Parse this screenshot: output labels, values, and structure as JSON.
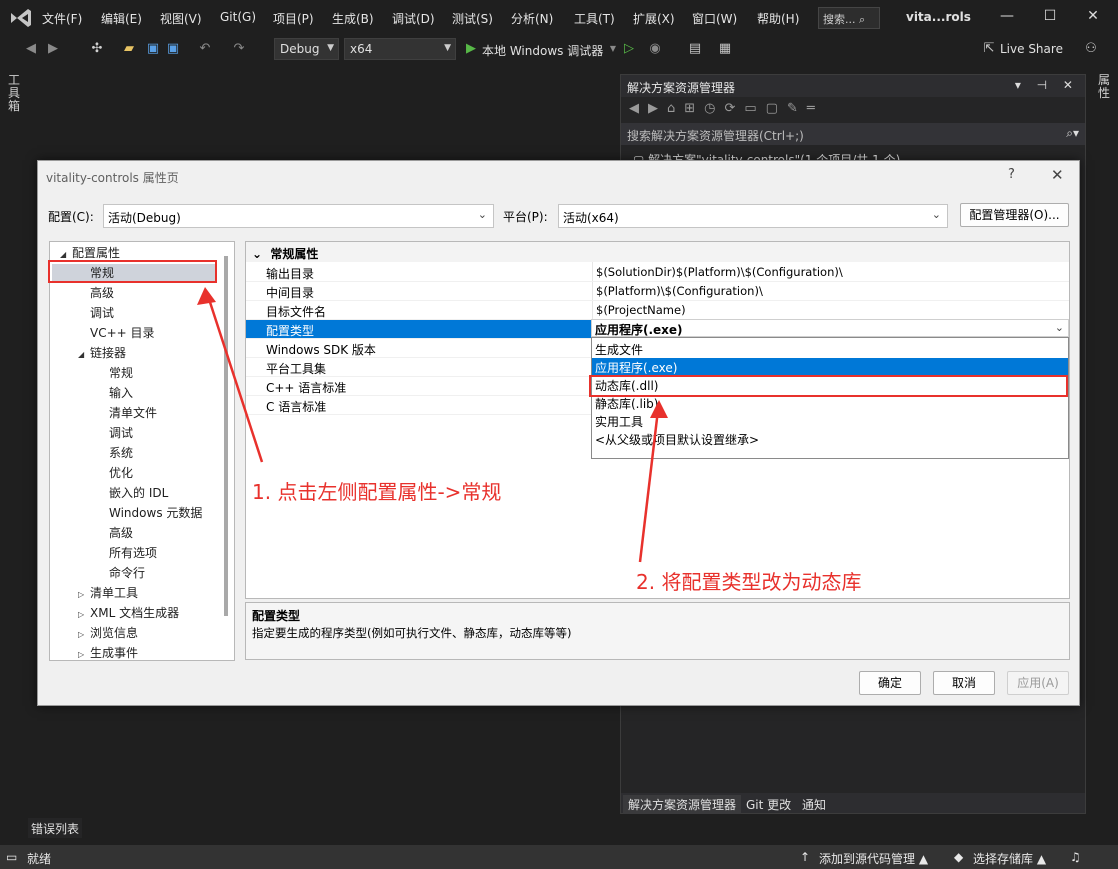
{
  "menu": [
    "文件(F)",
    "编辑(E)",
    "视图(V)",
    "Git(G)",
    "项目(P)",
    "生成(B)",
    "调试(D)",
    "测试(S)",
    "分析(N)",
    "工具(T)",
    "扩展(X)",
    "窗口(W)",
    "帮助(H)"
  ],
  "search_label": "搜索...",
  "window_title": "vita...rols",
  "toolbar": {
    "config": "Debug",
    "platform": "x64",
    "run_label": "本地 Windows 调试器",
    "live_share": "Live Share"
  },
  "left_vertical_tab": "工具箱",
  "right_vertical_tab": "属性",
  "solution_explorer": {
    "title": "解决方案资源管理器",
    "search_placeholder": "搜索解决方案资源管理器(Ctrl+;)",
    "root_item": "解决方案\"vitality-controls\"(1 个项目/共 1 个)",
    "tabs": [
      "解决方案资源管理器",
      "Git 更改",
      "通知"
    ]
  },
  "error_list_tab": "错误列表",
  "status": {
    "ready": "就绪",
    "add_source": "添加到源代码管理",
    "select_repo": "选择存储库"
  },
  "dialog": {
    "title": "vitality-controls 属性页",
    "config_label": "配置(C):",
    "config_value": "活动(Debug)",
    "platform_label": "平台(P):",
    "platform_value": "活动(x64)",
    "config_manager_button": "配置管理器(O)...",
    "tree": [
      {
        "label": "配置属性",
        "level": 0,
        "arrow": "expanded"
      },
      {
        "label": "常规",
        "level": 1,
        "arrow": "none",
        "selected": true
      },
      {
        "label": "高级",
        "level": 1,
        "arrow": "none"
      },
      {
        "label": "调试",
        "level": 1,
        "arrow": "none"
      },
      {
        "label": "VC++ 目录",
        "level": 1,
        "arrow": "none"
      },
      {
        "label": "链接器",
        "level": 1,
        "arrow": "expanded"
      },
      {
        "label": "常规",
        "level": 2,
        "arrow": "none"
      },
      {
        "label": "输入",
        "level": 2,
        "arrow": "none"
      },
      {
        "label": "清单文件",
        "level": 2,
        "arrow": "none"
      },
      {
        "label": "调试",
        "level": 2,
        "arrow": "none"
      },
      {
        "label": "系统",
        "level": 2,
        "arrow": "none"
      },
      {
        "label": "优化",
        "level": 2,
        "arrow": "none"
      },
      {
        "label": "嵌入的 IDL",
        "level": 2,
        "arrow": "none"
      },
      {
        "label": "Windows 元数据",
        "level": 2,
        "arrow": "none"
      },
      {
        "label": "高级",
        "level": 2,
        "arrow": "none"
      },
      {
        "label": "所有选项",
        "level": 2,
        "arrow": "none"
      },
      {
        "label": "命令行",
        "level": 2,
        "arrow": "none"
      },
      {
        "label": "清单工具",
        "level": 1,
        "arrow": "collapsed"
      },
      {
        "label": "XML 文档生成器",
        "level": 1,
        "arrow": "collapsed"
      },
      {
        "label": "浏览信息",
        "level": 1,
        "arrow": "collapsed"
      },
      {
        "label": "生成事件",
        "level": 1,
        "arrow": "collapsed"
      }
    ],
    "grid_category": "常规属性",
    "properties": [
      {
        "name": "输出目录",
        "value": "$(SolutionDir)$(Platform)\\$(Configuration)\\"
      },
      {
        "name": "中间目录",
        "value": "$(Platform)\\$(Configuration)\\"
      },
      {
        "name": "目标文件名",
        "value": "$(ProjectName)"
      },
      {
        "name": "配置类型",
        "value": "",
        "selected": true
      },
      {
        "name": "Windows SDK 版本",
        "value": ""
      },
      {
        "name": "平台工具集",
        "value": ""
      },
      {
        "name": "C++ 语言标准",
        "value": ""
      },
      {
        "name": "C 语言标准",
        "value": ""
      }
    ],
    "config_type_current": "应用程序(.exe)",
    "config_type_options": [
      "生成文件",
      "应用程序(.exe)",
      "动态库(.dll)",
      "静态库(.lib)",
      "实用工具",
      "<从父级或项目默认设置继承>"
    ],
    "desc_title": "配置类型",
    "desc_text": "指定要生成的程序类型(例如可执行文件、静态库，动态库等等)",
    "ok": "确定",
    "cancel": "取消",
    "apply": "应用(A)"
  },
  "annotations": {
    "step1": "1. 点击左侧配置属性->常规",
    "step2": "2. 将配置类型改为动态库",
    "color": "#e8312c"
  }
}
